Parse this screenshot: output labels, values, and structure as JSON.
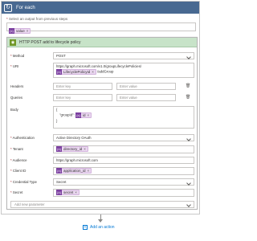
{
  "foreach": {
    "title": "For each",
    "select_label": "Select an output from previous steps",
    "token": "value",
    "required_marker": "*"
  },
  "action": {
    "title": "HTTP POST add to lifecycle policy",
    "method": {
      "label": "Method",
      "value": "POST"
    },
    "uri": {
      "label": "URI",
      "line1": "https://graph.microsoft.com/v1.0/groupLifecyclePolicies/",
      "token": "LifecyclePolicyId",
      "suffix": "/addGroup"
    },
    "headers": {
      "label": "Headers",
      "key_placeholder": "Enter key",
      "value_placeholder": "Enter value"
    },
    "queries": {
      "label": "Queries",
      "key_placeholder": "Enter key",
      "value_placeholder": "Enter value"
    },
    "body": {
      "label": "Body",
      "open": "{",
      "key": "\"groupId\":",
      "token": "id",
      "close": "}"
    },
    "authentication": {
      "label": "Authentication",
      "value": "Active Directory OAuth"
    },
    "tenant": {
      "label": "Tenant",
      "token": "directory_id"
    },
    "audience": {
      "label": "Audience",
      "value": "https://graph.microsoft.com"
    },
    "client_id": {
      "label": "Client ID",
      "token": "application_id"
    },
    "credential_type": {
      "label": "Credential Type",
      "value": "Secret"
    },
    "secret": {
      "label": "Secret",
      "token": "secret"
    },
    "add_param": "Add new parameter"
  },
  "add_action": "Add an action",
  "colors": {
    "foreach_header": "#486991",
    "action_header": "#c7e3c8",
    "token_bg": "#ead7f0",
    "token_icon": "#7b3fa0",
    "link": "#0078d4"
  }
}
